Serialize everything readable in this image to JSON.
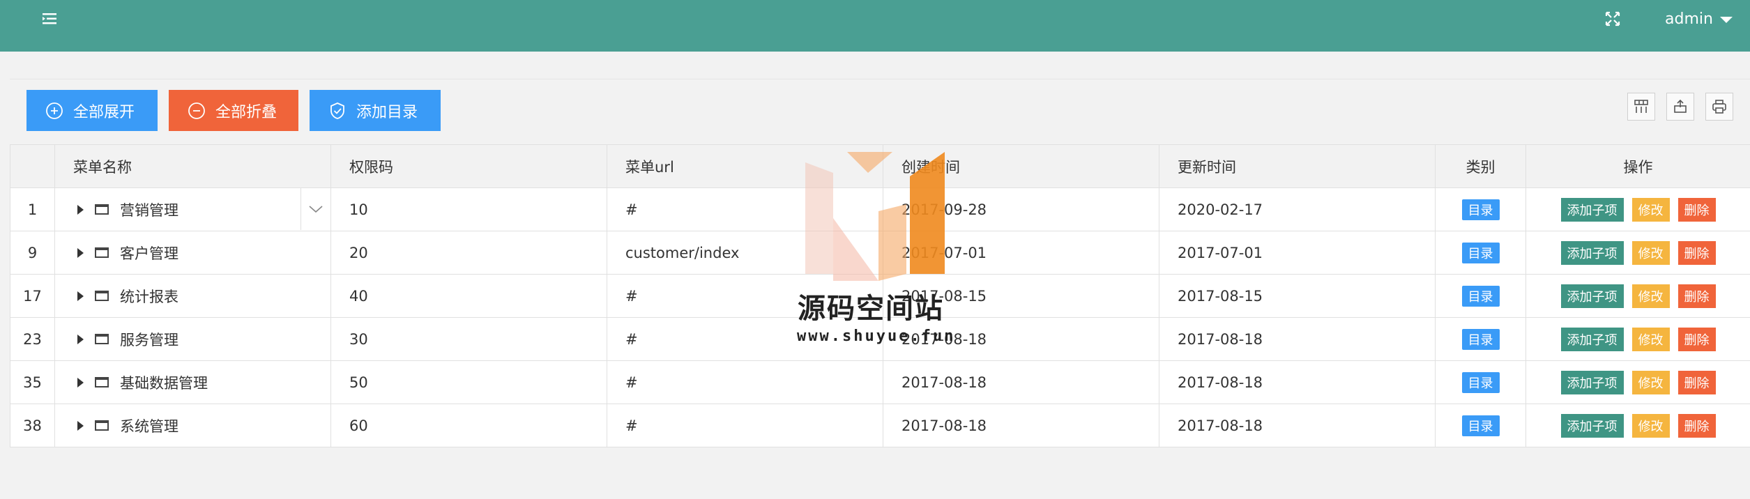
{
  "header": {
    "user_label": "admin",
    "icons": [
      "menu-toggle-icon",
      "fullscreen-icon",
      "chevron-down-icon"
    ],
    "accent_color": "#4a9f93"
  },
  "toolbar": {
    "expand_all_label": "全部展开",
    "collapse_all_label": "全部折叠",
    "add_directory_label": "添加目录",
    "tools": [
      "columns-icon",
      "export-icon",
      "print-icon"
    ]
  },
  "table": {
    "columns": [
      "",
      "菜单名称",
      "权限码",
      "菜单url",
      "创建时间",
      "更新时间",
      "类别",
      "操作"
    ],
    "rows": [
      {
        "id": "1",
        "name": "营销管理",
        "code": "10",
        "url": "#",
        "created": "2017-09-28",
        "updated": "2020-02-17",
        "type": "目录"
      },
      {
        "id": "9",
        "name": "客户管理",
        "code": "20",
        "url": "customer/index",
        "created": "2017-07-01",
        "updated": "2017-07-01",
        "type": "目录"
      },
      {
        "id": "17",
        "name": "统计报表",
        "code": "40",
        "url": "#",
        "created": "2017-08-15",
        "updated": "2017-08-15",
        "type": "目录"
      },
      {
        "id": "23",
        "name": "服务管理",
        "code": "30",
        "url": "#",
        "created": "2017-08-18",
        "updated": "2017-08-18",
        "type": "目录"
      },
      {
        "id": "35",
        "name": "基础数据管理",
        "code": "50",
        "url": "#",
        "created": "2017-08-18",
        "updated": "2017-08-18",
        "type": "目录"
      },
      {
        "id": "38",
        "name": "系统管理",
        "code": "60",
        "url": "#",
        "created": "2017-08-18",
        "updated": "2017-08-18",
        "type": "目录"
      }
    ],
    "actions": {
      "add_child": "添加子项",
      "edit": "修改",
      "delete": "删除"
    }
  },
  "watermark": {
    "title": "源码空间站",
    "url": "www.shuyue.fun"
  },
  "colors": {
    "primary": "#3a9bf7",
    "danger": "#f0643a",
    "warning": "#f5b53f",
    "success": "#3f9584"
  }
}
